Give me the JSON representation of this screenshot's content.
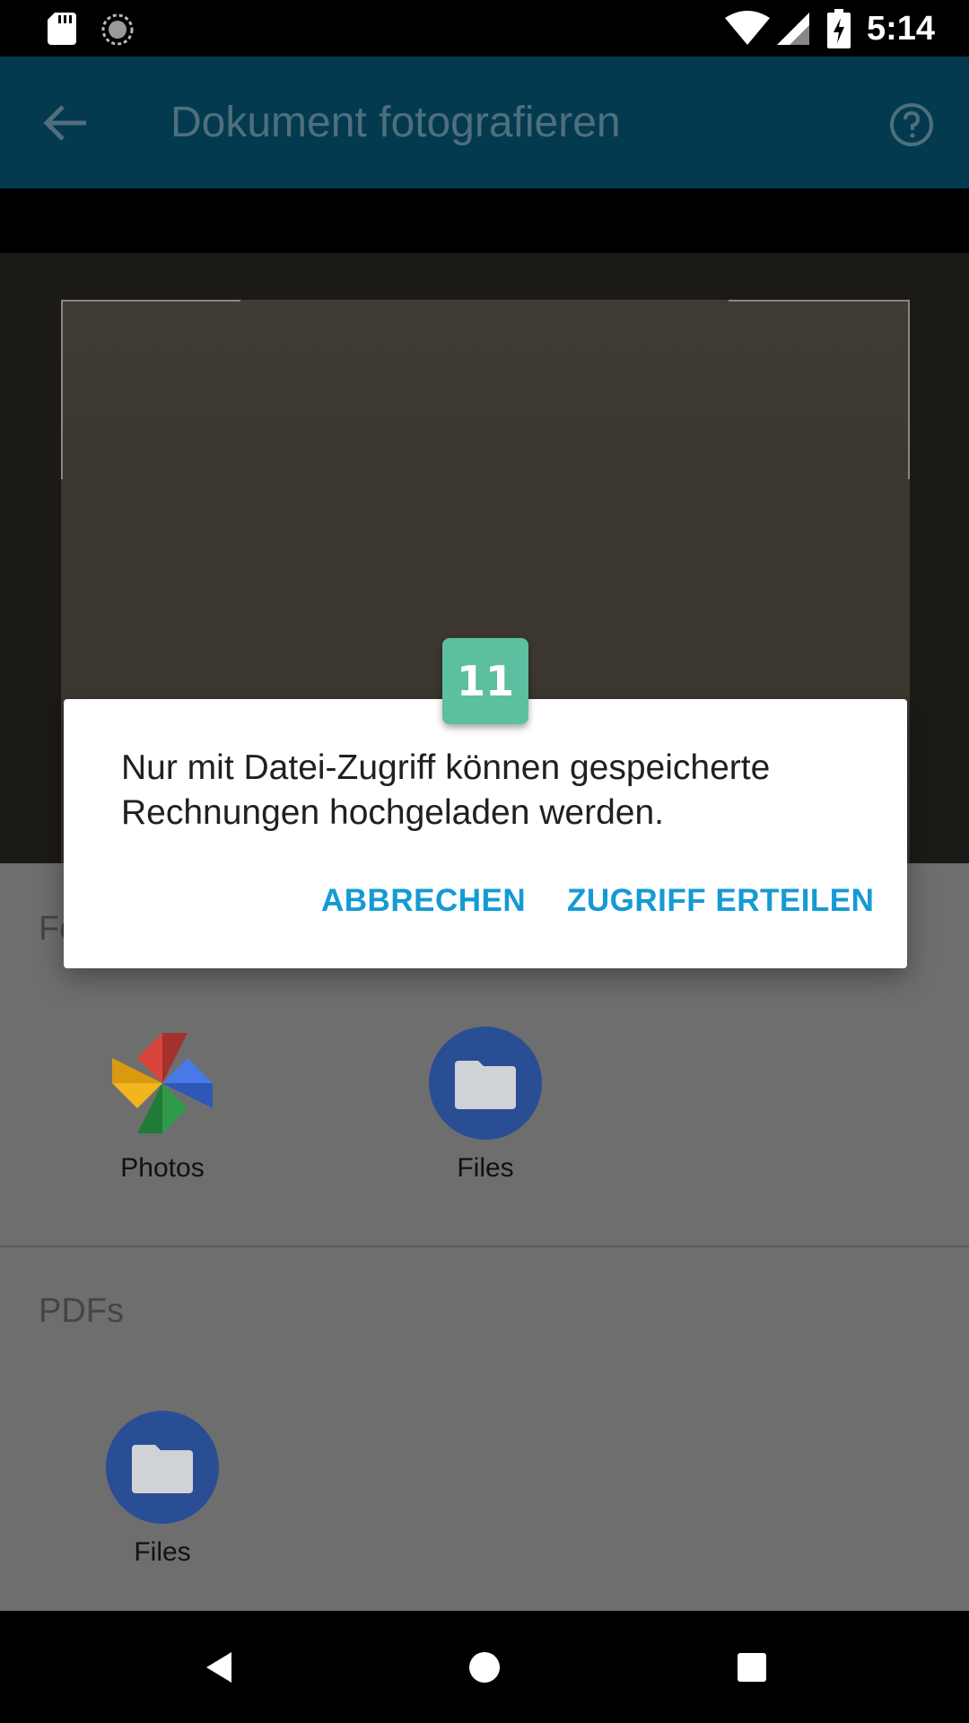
{
  "status_bar": {
    "time": "5:14",
    "icons": [
      "sd-card-icon",
      "sync-spinner-icon",
      "wifi-icon",
      "signal-icon",
      "battery-charging-icon"
    ]
  },
  "app_bar": {
    "title": "Dokument fotografieren",
    "back_icon": "arrow-back-icon",
    "help_icon": "help-circle-icon",
    "color": "#033a50"
  },
  "sheet": {
    "section_1_title": "Fo",
    "section_1_apps": [
      {
        "label": "Photos",
        "icon": "google-photos-icon"
      },
      {
        "label": "Files",
        "icon": "folder-icon"
      }
    ],
    "section_2_title": "PDFs",
    "section_2_apps": [
      {
        "label": "Files",
        "icon": "folder-icon"
      }
    ]
  },
  "dialog": {
    "message": "Nur mit Datei-Zugriff können gespeicherte Rechnungen hochgeladen werden.",
    "cancel_label": "ABBRECHEN",
    "grant_label": "ZUGRIFF ERTEILEN",
    "accent_color": "#149ad4"
  },
  "badge": {
    "number": "11",
    "color": "#5cbfa0"
  },
  "nav_bar": {
    "icons": [
      "nav-back-icon",
      "nav-home-icon",
      "nav-recents-icon"
    ]
  }
}
